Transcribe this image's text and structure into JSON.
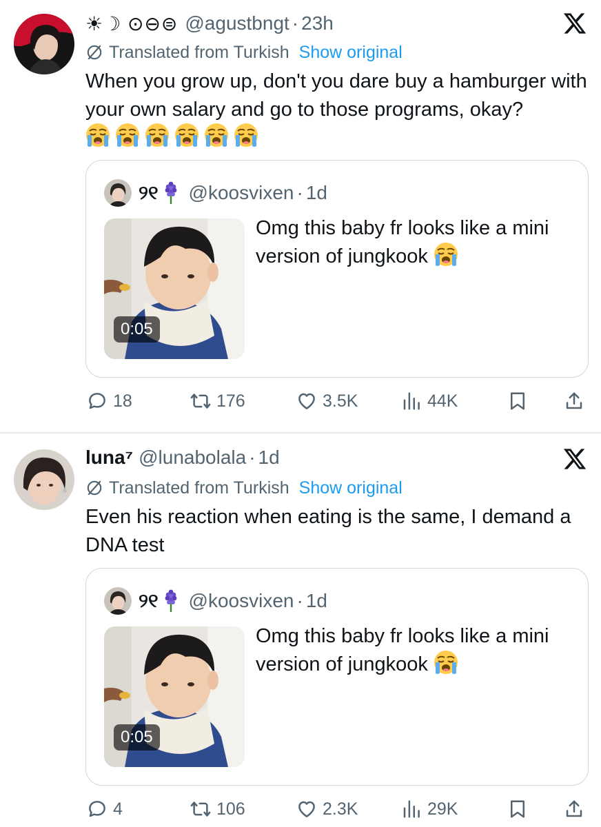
{
  "tweets": [
    {
      "name": "",
      "name_glyphs": "☀︎☽ ⊙⊖⊜",
      "handle": "@agustbngt",
      "time": "23h",
      "translated_label": "Translated from Turkish",
      "show_original": "Show original",
      "text": "When you grow up, don't you dare buy a hamburger with your own salary and go to those programs, okay?",
      "emoji_count": 6,
      "quote": {
        "name": "୨୧",
        "handle": "@koosvixen",
        "time": "1d",
        "text": "Omg this baby fr looks like a mini version of jungkook",
        "video_duration": "0:05"
      },
      "stats": {
        "replies": "18",
        "reposts": "176",
        "likes": "3.5K",
        "views": "44K"
      }
    },
    {
      "name": "luna⁷",
      "handle": "@lunabolala",
      "time": "1d",
      "translated_label": "Translated from Turkish",
      "show_original": "Show original",
      "text": "Even his reaction when eating is the same, I demand a DNA test",
      "quote": {
        "name": "୨୧",
        "handle": "@koosvixen",
        "time": "1d",
        "text": "Omg this baby fr looks like a mini version of jungkook",
        "video_duration": "0:05"
      },
      "stats": {
        "replies": "4",
        "reposts": "106",
        "likes": "2.3K",
        "views": "29K"
      }
    }
  ],
  "dot_separator": "·",
  "icons": {
    "close": "x-logo-icon",
    "translate": "globe-slash-icon",
    "reply": "reply-icon",
    "repost": "repost-icon",
    "like": "heart-icon",
    "views": "views-icon",
    "bookmark": "bookmark-icon",
    "share": "share-icon",
    "emoji": "loudly-crying-face-emoji",
    "quote_flower": "hyacinth-emoji"
  },
  "colors": {
    "link": "#1d9bf0",
    "muted": "#536471",
    "text": "#0f1419",
    "border": "#cfd9de"
  }
}
